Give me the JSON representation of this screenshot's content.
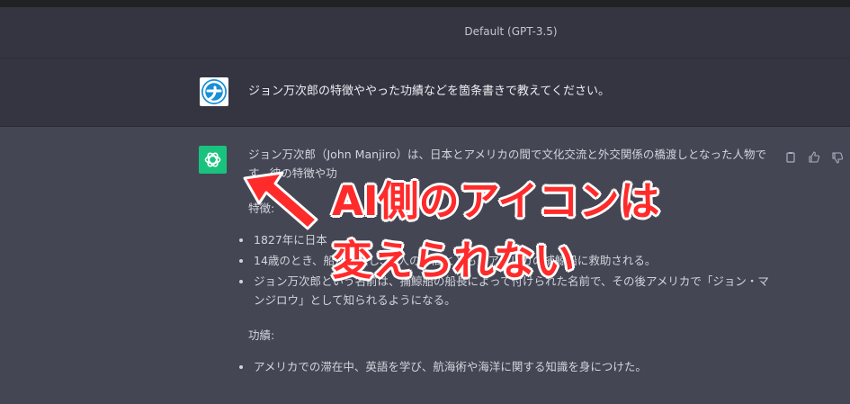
{
  "header": {
    "model_label": "Default (GPT-3.5)"
  },
  "user_message": {
    "text": "ジョン万次郎の特徴ややった功績などを箇条書きで教えてください。"
  },
  "assistant_message": {
    "intro": "ジョン万次郎（John Manjiro）は、日本とアメリカの間で文化交流と外交関係の橋渡しとなった人物です。彼の特徴や功",
    "features_heading": "特徴:",
    "features": [
      "1827年に日本",
      "14歳のとき、船が難破し、4人の仲間とともにアメリカの捕鯨船に救助される。",
      "ジョン万次郎という名前は、捕鯨船の船長によって付けられた名前で、その後アメリカで「ジョン・マンジロウ」として知られるようになる。"
    ],
    "achievements_heading": "功績:",
    "achievements": [
      "アメリカでの滞在中、英語を学び、航海術や海洋に関する知識を身につけた。"
    ]
  },
  "annotation": {
    "line1": "AI側のアイコンは",
    "line2": "変えられない"
  },
  "colors": {
    "accent": "#19c37d",
    "annotation": "#ff2b2b"
  }
}
